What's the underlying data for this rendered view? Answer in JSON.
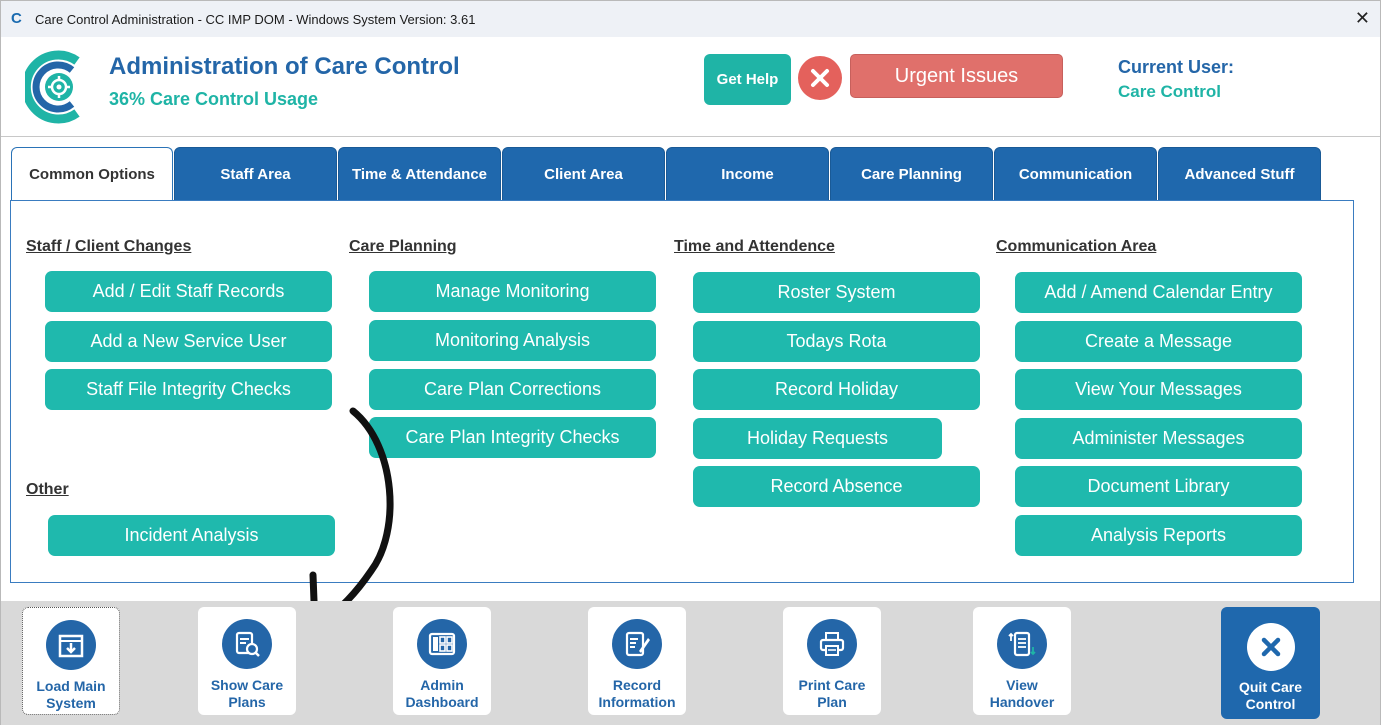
{
  "window": {
    "title": "Care Control Administration - CC IMP DOM - Windows System Version: 3.61",
    "close_glyph": "✕"
  },
  "header": {
    "app_title": "Administration of Care Control",
    "usage": "36% Care Control Usage",
    "get_help": "Get Help",
    "urgent_issues": "Urgent Issues",
    "current_user_label": "Current User:",
    "current_user_value": "Care Control"
  },
  "tabs": [
    {
      "label": "Common Options",
      "active": true
    },
    {
      "label": "Staff Area"
    },
    {
      "label": "Time & Attendance"
    },
    {
      "label": "Client Area"
    },
    {
      "label": "Income"
    },
    {
      "label": "Care Planning"
    },
    {
      "label": "Communication"
    },
    {
      "label": "Advanced Stuff"
    }
  ],
  "sections": {
    "staff_client": {
      "title": "Staff / Client Changes",
      "buttons": [
        "Add / Edit Staff Records",
        "Add a New Service User",
        "Staff File Integrity Checks"
      ]
    },
    "care_planning": {
      "title": "Care Planning",
      "buttons": [
        "Manage Monitoring",
        "Monitoring Analysis",
        "Care Plan Corrections",
        "Care Plan Integrity Checks"
      ]
    },
    "time": {
      "title": "Time and Attendence",
      "buttons": [
        "Roster System",
        "Todays Rota",
        "Record Holiday",
        "Holiday Requests",
        "Record Absence"
      ]
    },
    "communication": {
      "title": "Communication Area",
      "buttons": [
        "Add / Amend Calendar Entry",
        "Create a Message",
        "View Your Messages",
        "Administer Messages",
        "Document Library",
        "Analysis Reports"
      ]
    },
    "other": {
      "title": "Other",
      "buttons": [
        "Incident Analysis"
      ]
    }
  },
  "bottom_bar": {
    "load_main": "Load Main\nSystem",
    "show_care_plans": "Show Care\nPlans",
    "admin_dashboard": "Admin\nDashboard",
    "record_information": "Record\nInformation",
    "print_care_plan": "Print Care\nPlan",
    "view_handover": "View\nHandover",
    "quit": "Quit Care\nControl"
  },
  "colors": {
    "brand_blue": "#2466a8",
    "teal": "#1fb9ad",
    "urgent_red": "#e0706b"
  }
}
